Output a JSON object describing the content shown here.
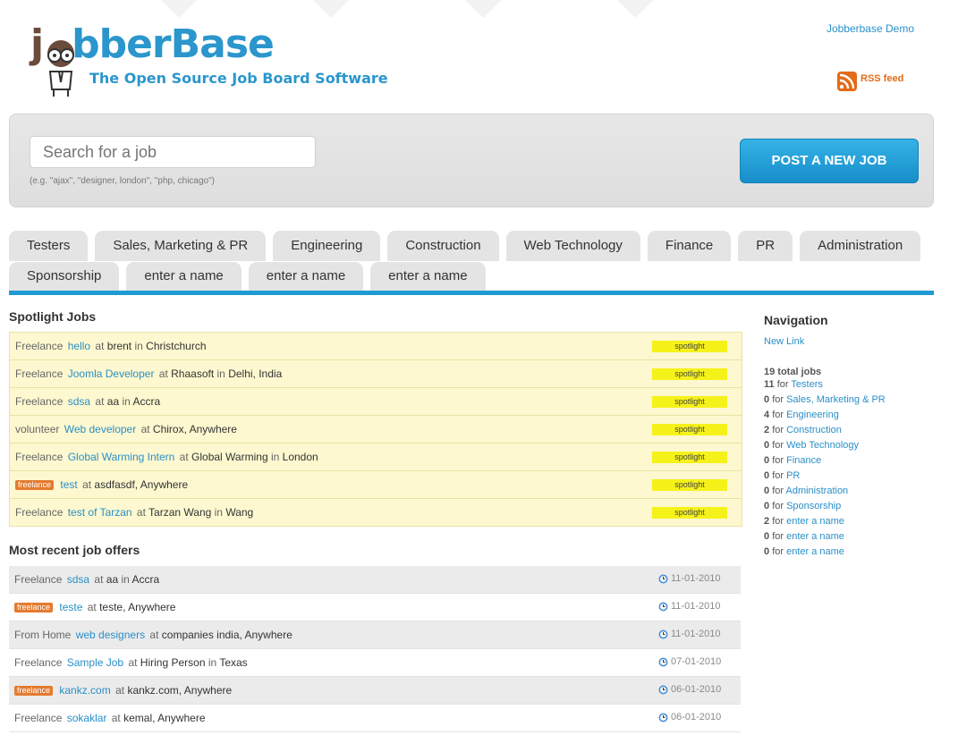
{
  "header": {
    "logo_text_a": "j",
    "logo_text_b": "bber",
    "logo_text_c": "Base",
    "tagline": "The Open Source Job Board Software",
    "demo_link": "Jobberbase Demo",
    "rss_label": "RSS feed"
  },
  "search": {
    "placeholder": "Search for a job",
    "hint": "(e.g. \"ajax\", \"designer, london\", \"php, chicago\")",
    "post_button": "POST A NEW JOB"
  },
  "tabs_row1": [
    "Testers",
    "Sales, Marketing & PR",
    "Engineering",
    "Construction",
    "Web Technology",
    "Finance",
    "PR",
    "Administration"
  ],
  "tabs_row2": [
    "Sponsorship",
    "enter a name",
    "enter a name",
    "enter a name"
  ],
  "spotlight": {
    "heading": "Spotlight Jobs",
    "badge": "spotlight",
    "jobs": [
      {
        "type": "Freelance",
        "title": "hello",
        "at": "at",
        "company": "brent",
        "in": "in",
        "location": "Christchurch"
      },
      {
        "type": "Freelance",
        "title": "Joomla Developer",
        "at": "at",
        "company": "Rhaasoft",
        "in": "in",
        "location": "Delhi, India"
      },
      {
        "type": "Freelance",
        "title": "sdsa",
        "at": "at",
        "company": "aa",
        "in": "in",
        "location": "Accra"
      },
      {
        "type": "volunteer",
        "title": "Web developer",
        "at": "at",
        "company": "Chirox, Anywhere",
        "in": "",
        "location": ""
      },
      {
        "type": "Freelance",
        "title": "Global Warming Intern",
        "at": "at",
        "company": "Global Warming",
        "in": "in",
        "location": "London"
      },
      {
        "type": "freelance",
        "badge": true,
        "title": "test",
        "at": "at",
        "company": "asdfasdf, Anywhere",
        "in": "",
        "location": ""
      },
      {
        "type": "Freelance",
        "title": "test of Tarzan",
        "at": "at",
        "company": "Tarzan Wang",
        "in": "in",
        "location": "Wang"
      }
    ]
  },
  "recent": {
    "heading": "Most recent job offers",
    "jobs": [
      {
        "type": "Freelance",
        "title": "sdsa",
        "at": "at",
        "company": "aa",
        "in": "in",
        "location": "Accra",
        "date": "11-01-2010"
      },
      {
        "type": "freelance",
        "badge": true,
        "title": "teste",
        "at": "at",
        "company": "teste, Anywhere",
        "in": "",
        "location": "",
        "date": "11-01-2010"
      },
      {
        "type": "From Home",
        "title": "web designers",
        "at": "at",
        "company": "companies india, Anywhere",
        "in": "",
        "location": "",
        "date": "11-01-2010"
      },
      {
        "type": "Freelance",
        "title": "Sample Job",
        "at": "at",
        "company": "Hiring Person",
        "in": "in",
        "location": "Texas",
        "date": "07-01-2010"
      },
      {
        "type": "freelance",
        "badge": true,
        "title": "kankz.com",
        "at": "at",
        "company": "kankz.com, Anywhere",
        "in": "",
        "location": "",
        "date": "06-01-2010"
      },
      {
        "type": "Freelance",
        "title": "sokaklar",
        "at": "at",
        "company": "kemal, Anywhere",
        "in": "",
        "location": "",
        "date": "06-01-2010"
      }
    ]
  },
  "sidebar": {
    "heading": "Navigation",
    "new_link": "New Link",
    "total": "19 total jobs",
    "for_word": "for",
    "counts": [
      {
        "n": "11",
        "cat": "Testers"
      },
      {
        "n": "0",
        "cat": "Sales, Marketing & PR"
      },
      {
        "n": "4",
        "cat": "Engineering"
      },
      {
        "n": "2",
        "cat": "Construction"
      },
      {
        "n": "0",
        "cat": "Web Technology"
      },
      {
        "n": "0",
        "cat": "Finance"
      },
      {
        "n": "0",
        "cat": "PR"
      },
      {
        "n": "0",
        "cat": "Administration"
      },
      {
        "n": "0",
        "cat": "Sponsorship"
      },
      {
        "n": "2",
        "cat": "enter a name"
      },
      {
        "n": "0",
        "cat": "enter a name"
      },
      {
        "n": "0",
        "cat": "enter a name"
      }
    ]
  },
  "colors": {
    "brand_blue": "#2b96cc",
    "logo_brown": "#6b4b3a",
    "spotlight_bg": "#fdf8cf",
    "spotlight_badge": "#f5f21a",
    "freelance_badge": "#e47b2f",
    "rss_orange": "#e36b19"
  }
}
